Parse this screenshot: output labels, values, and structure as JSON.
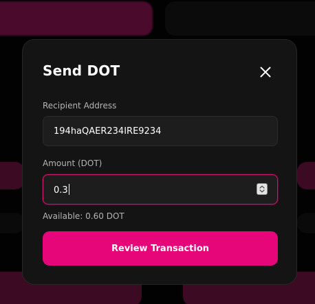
{
  "colors": {
    "accent": "#e6067a",
    "modal_background": "#141414",
    "input_background": "#1d1d1d",
    "focus_border": "#d1126e"
  },
  "modal": {
    "title": "Send DOT",
    "close_icon": "close-icon",
    "recipient": {
      "label": "Recipient Address",
      "value": "194haQAER234IRE9234"
    },
    "amount": {
      "label": "Amount (DOT)",
      "value": "0.3",
      "spinner_icon": "number-spinner-icon"
    },
    "available": "Available: 0.60 DOT",
    "review_button_label": "Review Transaction"
  }
}
